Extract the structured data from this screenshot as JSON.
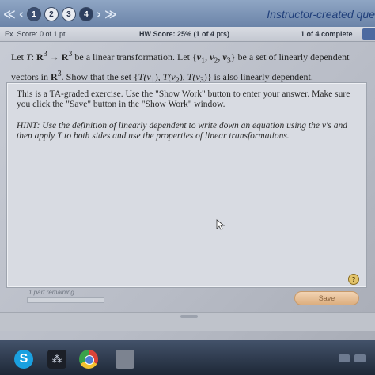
{
  "nav": {
    "arrow_first": "≪",
    "arrow_prev": "‹",
    "arrow_next": "›",
    "arrow_last": "≫",
    "questions": [
      "1",
      "2",
      "3",
      "4"
    ],
    "title": "Instructor-created questi"
  },
  "scores": {
    "ex_score": "Ex. Score: 0 of 1 pt",
    "hw_score": "HW Score: 25% (1 of 4 pts)",
    "complete": "1 of 4 complete"
  },
  "question": {
    "line1_a": "Let ",
    "line1_T": "T",
    "line1_b": ": ",
    "line1_R3a": "R",
    "line1_exp1": "3",
    "line1_arrow": " → ",
    "line1_R3b": "R",
    "line1_exp2": "3",
    "line1_c": " be a linear transformation.  Let {",
    "v1": "v",
    "s1": "1",
    "comma1": ", ",
    "v2": "v",
    "s2": "2",
    "comma2": ", ",
    "v3": "v",
    "s3": "3",
    "line1_d": "} be a set of linearly dependent",
    "line2_a": "vectors in ",
    "line2_R": "R",
    "line2_exp": "3",
    "line2_b": ".  Show that the set {",
    "t1": "T(v",
    "t1s": "1",
    "t1e": "), ",
    "t2": "T(v",
    "t2s": "2",
    "t2e": "), ",
    "t3": "T(v",
    "t3s": "3",
    "t3e": ")",
    "line2_c": "} is also linearly dependent."
  },
  "work": {
    "ta_note": "This is a TA-graded exercise.  Use the \"Show Work\" button to enter your answer.  Make sure you click the \"Save\" button in the \"Show Work\" window.",
    "hint": "HINT: Use the definition of linearly dependent to write down an equation using the v's and then apply T to both sides and use the properties of linear transformations.",
    "help": "?"
  },
  "footer": {
    "parts_remaining": "1 part remaining",
    "progress": 0.0,
    "save_label": "Save"
  },
  "taskbar": {
    "skype": "S",
    "bb": "⁂"
  },
  "colors": {
    "nav_bar": "#7a92b6",
    "title_blue": "#1f3e7a",
    "save_button": "#dcae7f",
    "progress_fill": "#d99a4a"
  }
}
